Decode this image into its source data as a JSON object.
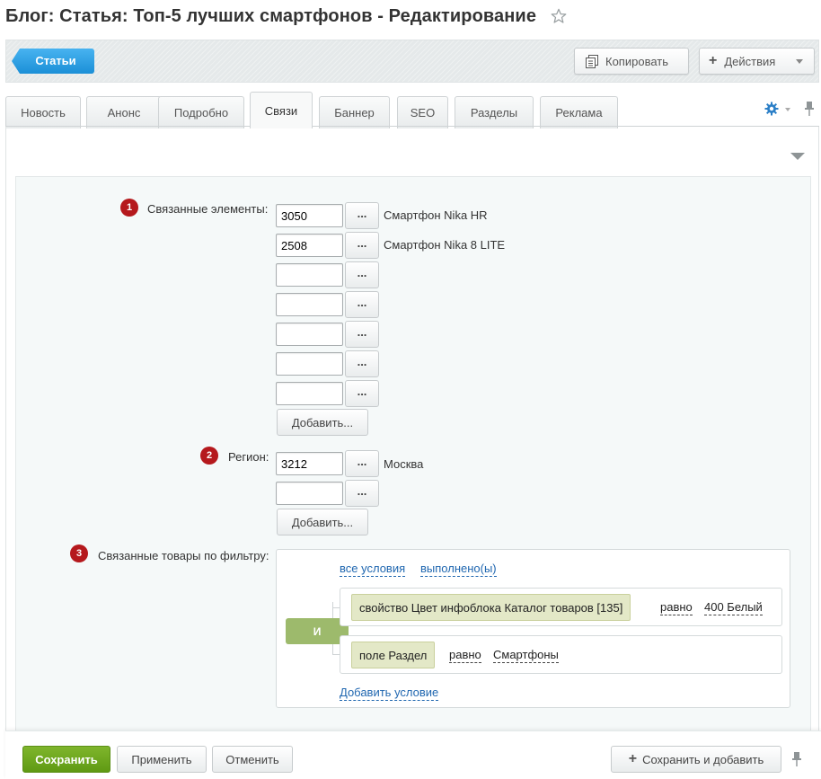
{
  "header": {
    "title": "Блог: Статья: Топ-5 лучших смартфонов - Редактирование"
  },
  "toolbar": {
    "back_label": "Статьи",
    "copy_label": "Копировать",
    "actions_label": "Действия"
  },
  "tabs": [
    {
      "label": "Новость"
    },
    {
      "label": "Анонс"
    },
    {
      "label": "Подробно"
    },
    {
      "label": "Связи"
    },
    {
      "label": "Баннер"
    },
    {
      "label": "SEO"
    },
    {
      "label": "Разделы"
    },
    {
      "label": "Реклама"
    }
  ],
  "active_tab": "Связи",
  "related": {
    "badge": "1",
    "label": "Связанные элементы:",
    "rows": [
      {
        "id": "3050",
        "name": "Смартфон Nika HR"
      },
      {
        "id": "2508",
        "name": "Смартфон Nika 8 LITE"
      },
      {
        "id": "",
        "name": ""
      },
      {
        "id": "",
        "name": ""
      },
      {
        "id": "",
        "name": ""
      },
      {
        "id": "",
        "name": ""
      },
      {
        "id": "",
        "name": ""
      }
    ],
    "browse_label": "...",
    "add_label": "Добавить..."
  },
  "region": {
    "badge": "2",
    "label": "Регион:",
    "rows": [
      {
        "id": "3212",
        "name": "Москва"
      },
      {
        "id": "",
        "name": ""
      }
    ],
    "browse_label": "...",
    "add_label": "Добавить..."
  },
  "filter": {
    "badge": "3",
    "label": "Связанные товары по фильтру:",
    "all_conditions": "все условия",
    "fulfilled": "выполнено(ы)",
    "logic": "И",
    "conditions": [
      {
        "field": "свойство Цвет инфоблока Каталог товаров [135]",
        "operator": "равно",
        "value": "400 Белый"
      },
      {
        "field": "поле Раздел",
        "operator": "равно",
        "value": "Смартфоны"
      }
    ],
    "add_condition": "Добавить условие"
  },
  "footer": {
    "save": "Сохранить",
    "apply": "Применить",
    "cancel": "Отменить",
    "save_add": "Сохранить и добавить"
  },
  "colors": {
    "accent_blue": "#2b9fe6",
    "badge_red": "#b5191d",
    "and_green": "#9dba6c",
    "save_green": "#6ea722"
  }
}
